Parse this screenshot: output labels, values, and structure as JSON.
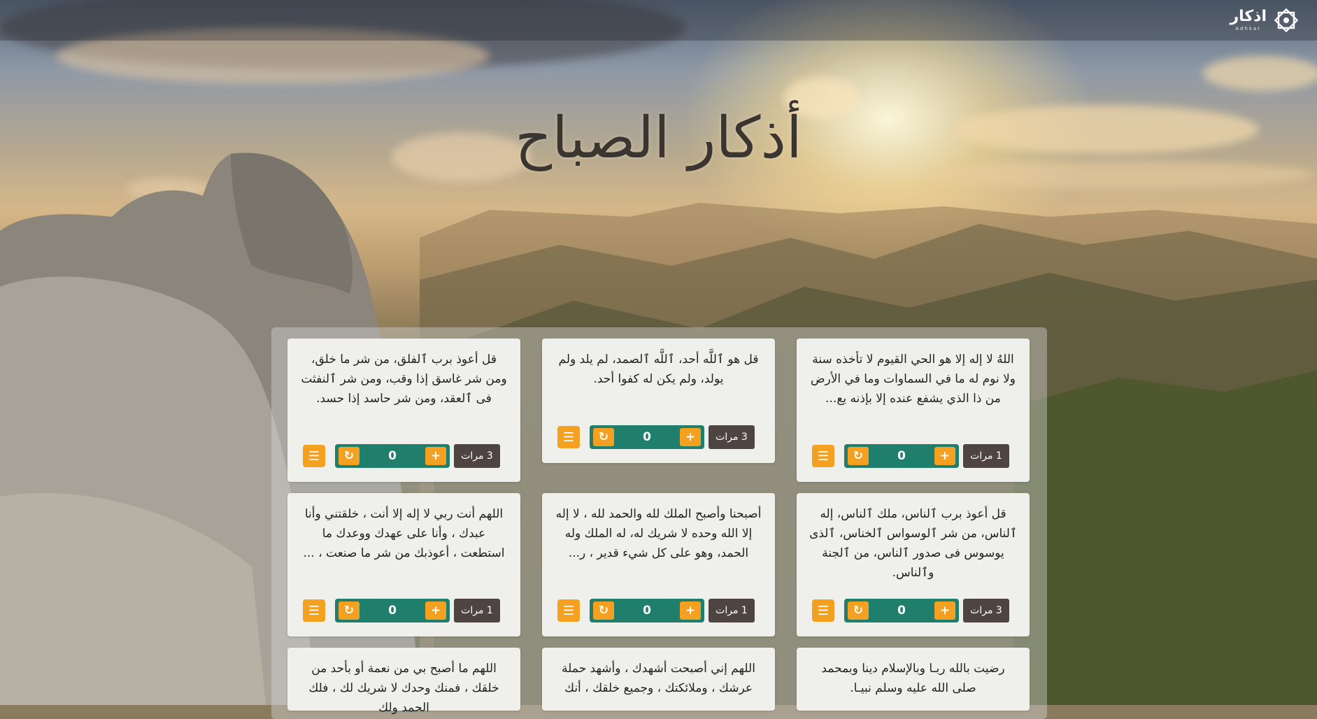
{
  "header": {
    "logo_text": "اذكار",
    "logo_sub": "Adhkar"
  },
  "page_title": "أذكار الصباح",
  "colors": {
    "accent": "#f4a020",
    "counter_bg": "#1f7f6c",
    "badge_bg": "#4e4542",
    "card_bg": "#efefec"
  },
  "icons": {
    "book": "book-icon",
    "reset": "refresh-icon",
    "plus": "plus-icon"
  },
  "cards": [
    {
      "text": "اللهُ لا إله إلا هو الحي القيوم لا تأخذه سنة ولا نوم له ما في السماوات وما في الأرض من ذا الذي يشفع عنده إلا بإذنه يع...",
      "count": "0",
      "times": "1 مرات"
    },
    {
      "text": "قل هو ٱللَّه أحد، ٱللَّه ٱلصمد، لم يلد ولم يولد، ولم يكن له كفوا أحد.",
      "count": "0",
      "times": "3 مرات"
    },
    {
      "text": "قل أعوذ برب ٱلفلق، من شر ما خلق، ومن شر غاسق إذا وقب، ومن شر ٱلنفثت فى ٱلعقد، ومن شر حاسد إذا حسد.",
      "count": "0",
      "times": "3 مرات"
    },
    {
      "text": "قل أعوذ برب ٱلناس، ملك ٱلناس، إله ٱلناس، من شر ٱلوسواس ٱلخناس، ٱلذى يوسوس فى صدور ٱلناس، من ٱلجنة وٱلناس.",
      "count": "0",
      "times": "3 مرات"
    },
    {
      "text": "أصبحنا وأصبح الملك لله والحمد لله ، لا إله إلا الله وحده لا شريك له، له الملك وله الحمد، وهو على كل شيء قدير ، ر...",
      "count": "0",
      "times": "1 مرات"
    },
    {
      "text": "اللهم أنت ربي لا إله إلا أنت ، خلقتني وأنا عبدك ، وأنا على عهدك ووعدك ما استطعت ، أعوذبك من شر ما صنعت ، ...",
      "count": "0",
      "times": "1 مرات"
    },
    {
      "text": "رضيت بالله ربـا وبالإسلام دينا وبمحمد صلى الله عليه وسلم نبيـا.",
      "count": "",
      "times": ""
    },
    {
      "text": "اللهم إني أصبحت أشهدك ، وأشهد حملة عرشك ، وملائكتك ، وجميع خلقك ، أنك",
      "count": "",
      "times": ""
    },
    {
      "text": "اللهم ما أصبح بي من نعمة أو بأحد من خلقك ، فمنك وحدك لا شريك لك ، فلك الحمد ولك",
      "count": "",
      "times": ""
    }
  ]
}
